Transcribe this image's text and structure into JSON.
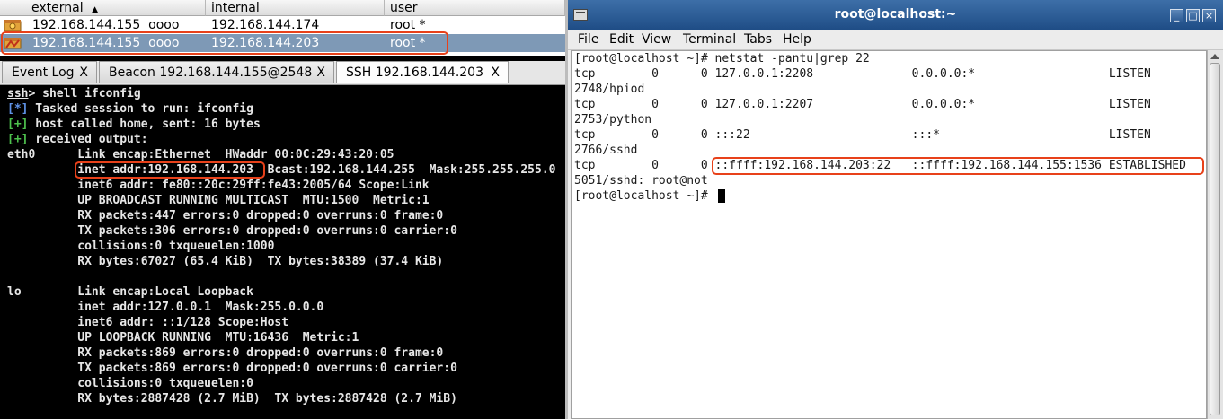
{
  "sessions": {
    "columns": [
      "external",
      "internal",
      "user"
    ],
    "sort_indicator": "▲",
    "rows": [
      {
        "external": "192.168.144.155  oooo",
        "internal": "192.168.144.174",
        "user": "root *",
        "selected": false
      },
      {
        "external": "192.168.144.155  oooo",
        "internal": "192.168.144.203",
        "user": "root *",
        "selected": true
      }
    ],
    "icon": "beacon-session-icon"
  },
  "tabs": [
    {
      "label": "Event Log",
      "close": "X",
      "active": false
    },
    {
      "label": "Beacon 192.168.144.155@2548",
      "close": "X",
      "active": false
    },
    {
      "label": "SSH 192.168.144.203",
      "close": "X",
      "active": true
    }
  ],
  "console": {
    "prompt": "ssh",
    "command": "> shell ifconfig",
    "lines": [
      {
        "tag": "[*]",
        "text": " Tasked session to run: ifconfig"
      },
      {
        "tag": "[+]",
        "text": " host called home, sent: 16 bytes"
      },
      {
        "tag": "[+]",
        "text": " received output:"
      }
    ],
    "output": [
      "eth0      Link encap:Ethernet  HWaddr 00:0C:29:43:20:05",
      "          inet addr:192.168.144.203  Bcast:192.168.144.255  Mask:255.255.255.0",
      "          inet6 addr: fe80::20c:29ff:fe43:2005/64 Scope:Link",
      "          UP BROADCAST RUNNING MULTICAST  MTU:1500  Metric:1",
      "          RX packets:447 errors:0 dropped:0 overruns:0 frame:0",
      "          TX packets:306 errors:0 dropped:0 overruns:0 carrier:0",
      "          collisions:0 txqueuelen:1000",
      "          RX bytes:67027 (65.4 KiB)  TX bytes:38389 (37.4 KiB)",
      "",
      "lo        Link encap:Local Loopback",
      "          inet addr:127.0.0.1  Mask:255.0.0.0",
      "          inet6 addr: ::1/128 Scope:Host",
      "          UP LOOPBACK RUNNING  MTU:16436  Metric:1",
      "          RX packets:869 errors:0 dropped:0 overruns:0 frame:0",
      "          TX packets:869 errors:0 dropped:0 overruns:0 carrier:0",
      "          collisions:0 txqueuelen:0",
      "          RX bytes:2887428 (2.7 MiB)  TX bytes:2887428 (2.7 MiB)"
    ]
  },
  "terminal": {
    "title": "root@localhost:~",
    "window_buttons": [
      "_",
      "□",
      "×"
    ],
    "menu": [
      "File",
      "Edit",
      "View",
      "Terminal",
      "Tabs",
      "Help"
    ],
    "lines": [
      "[root@localhost ~]# netstat -pantu|grep 22",
      "tcp        0      0 127.0.0.1:2208              0.0.0.0:*                   LISTEN",
      "2748/hpiod",
      "tcp        0      0 127.0.0.1:2207              0.0.0.0:*                   LISTEN",
      "2753/python",
      "tcp        0      0 :::22                       :::*                        LISTEN",
      "2766/sshd",
      "tcp        0      0 ::ffff:192.168.144.203:22   ::ffff:192.168.144.155:1536 ESTABLISHED",
      "5051/sshd: root@not",
      "[root@localhost ~]# "
    ]
  },
  "colors": {
    "highlight_border": "#e8411a",
    "selected_row": "#7e99b6",
    "titlebar": "#2c5a93",
    "console_bg": "#000000",
    "tag_blue": "#5f93e8",
    "tag_green": "#4ec24e"
  }
}
